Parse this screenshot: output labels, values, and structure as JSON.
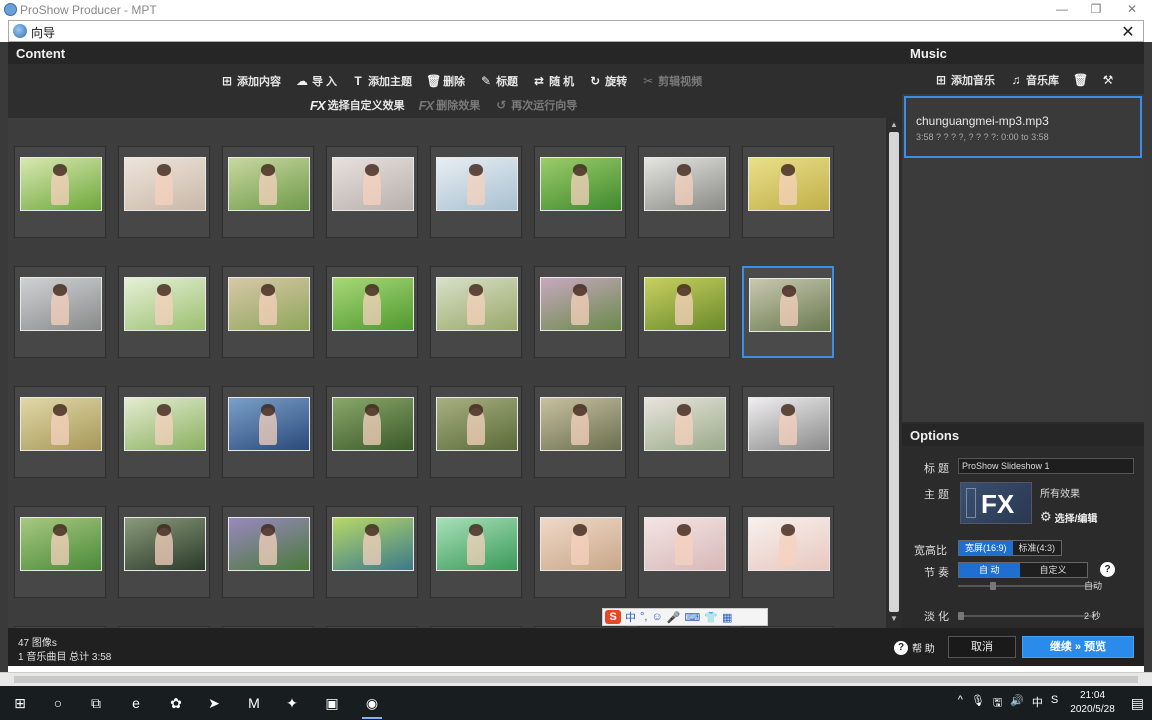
{
  "app": {
    "title": "ProShow Producer - MPT",
    "window_buttons": [
      "—",
      "❐",
      "✕"
    ]
  },
  "dialog": {
    "title": "向导",
    "close": "✕"
  },
  "content": {
    "header": "Content",
    "toolbar_row1": [
      {
        "icon": "plus-square-icon",
        "glyph": "⊞",
        "label": "添加内容",
        "dim": false
      },
      {
        "icon": "cloud-upload-icon",
        "glyph": "☁",
        "label": "导 入",
        "dim": false
      },
      {
        "icon": "title-text-icon",
        "glyph": "T",
        "label": "添加主题",
        "dim": false
      },
      {
        "icon": "trash-icon",
        "glyph": "🗑",
        "label": "删除",
        "dim": false
      },
      {
        "icon": "pencil-icon",
        "glyph": "✎",
        "label": "标题",
        "dim": false
      },
      {
        "icon": "shuffle-icon",
        "glyph": "⇄",
        "label": "随 机",
        "dim": false
      },
      {
        "icon": "rotate-icon",
        "glyph": "↻",
        "label": "旋转",
        "dim": false
      },
      {
        "icon": "crop-edit-icon",
        "glyph": "✂",
        "label": "剪辑视频",
        "dim": true
      }
    ],
    "toolbar_row2": [
      {
        "icon": "fx-icon",
        "glyph": "FX",
        "label": "选择自定义效果",
        "dim": false
      },
      {
        "icon": "fx-remove-icon",
        "glyph": "FX",
        "label": "删除效果",
        "dim": true
      },
      {
        "icon": "rerun-wizard-icon",
        "glyph": "↺",
        "label": "再次运行向导",
        "dim": true
      }
    ],
    "status_line1": "47 图像s",
    "status_line2": "1 音乐曲目 总计 3:58"
  },
  "thumbnails": {
    "rows": 4,
    "cols": 8,
    "selected_index": 15,
    "palettes": [
      [
        "#6ea83c",
        "#d8e8b0"
      ],
      [
        "#c9b8a8",
        "#eee4dc"
      ],
      [
        "#6f9a4a",
        "#c8d8a0"
      ],
      [
        "#b8b0ac",
        "#e8e0dc"
      ],
      [
        "#a8c0d0",
        "#e8eef2"
      ],
      [
        "#3f8a2e",
        "#9ccc6a"
      ],
      [
        "#8a8a86",
        "#e4e4e0"
      ],
      [
        "#c0b048",
        "#eadf8a"
      ],
      [
        "#8a8a8a",
        "#cfd2d4"
      ],
      [
        "#9cc070",
        "#e6f0d8"
      ],
      [
        "#8ea65a",
        "#d8c8a8"
      ],
      [
        "#4f9a2e",
        "#a8d878"
      ],
      [
        "#9aa86a",
        "#d8e0c8"
      ],
      [
        "#6a8a4a",
        "#c8a8c0"
      ],
      [
        "#6a8a2a",
        "#c8d060"
      ],
      [
        "#6a7a50",
        "#c8c8b0"
      ],
      [
        "#a89858",
        "#e0d8a8"
      ],
      [
        "#8ab060",
        "#e4ecd0"
      ],
      [
        "#2a4a7a",
        "#7aa0c8"
      ],
      [
        "#3a5a2a",
        "#8aa86a"
      ],
      [
        "#5a6a3a",
        "#a8b080"
      ],
      [
        "#6a7050",
        "#c8c0a0"
      ],
      [
        "#9aaa8a",
        "#e8e4dc"
      ],
      [
        "#8a8a8a",
        "#f0eef0"
      ],
      [
        "#4a8a3a",
        "#a8c880"
      ],
      [
        "#2a3a2a",
        "#8a9a7a"
      ],
      [
        "#4a7a3a",
        "#9a88c0"
      ],
      [
        "#3a7a8a",
        "#b8d868"
      ],
      [
        "#3a9a5a",
        "#a8e0b8"
      ],
      [
        "#c8a888",
        "#f0d8c8"
      ],
      [
        "#d8b8b8",
        "#f4e4e4"
      ],
      [
        "#e8c8c0",
        "#f8f0ec"
      ]
    ]
  },
  "music": {
    "header": "Music",
    "toolbar": [
      {
        "icon": "plus-square-icon",
        "glyph": "⊞",
        "label": "添加音乐"
      },
      {
        "icon": "music-note-icon",
        "glyph": "♫",
        "label": "音乐库"
      },
      {
        "icon": "trash-icon",
        "glyph": "🗑",
        "label": ""
      },
      {
        "icon": "tools-icon",
        "glyph": "⚒",
        "label": ""
      }
    ],
    "track_name": "chunguangmei-mp3.mp3",
    "track_info": "3:58 ? ? ? ?, ? ? ? ?: 0:00 to 3:58"
  },
  "options": {
    "header": "Options",
    "title_label": "标 题",
    "title_value": "ProShow Slideshow 1",
    "theme_label": "主 题",
    "theme_all": "所有效果",
    "theme_edit": "选择/编辑",
    "aspect_label": "宽高比",
    "aspect_options": [
      "宽屏(16:9)",
      "标准(4:3)"
    ],
    "aspect_selected": 0,
    "rhythm_label": "节 奏",
    "rhythm_options": [
      "自 动",
      "自定义"
    ],
    "rhythm_selected": 0,
    "rhythm_value": "自动",
    "fade_label": "淡 化",
    "fade_value": "2 秒"
  },
  "actions": {
    "help": "帮 助",
    "cancel": "取消",
    "continue": "继续 » 预览"
  },
  "ime": {
    "labels": [
      "中",
      "°,",
      "☺",
      "🎤",
      "⌨",
      "👕",
      "▦"
    ]
  },
  "taskbar": {
    "apps": [
      {
        "name": "start-button",
        "glyph": "⊞",
        "active": false
      },
      {
        "name": "cortana-icon",
        "glyph": "○",
        "active": false
      },
      {
        "name": "task-view-icon",
        "glyph": "⧉",
        "active": false
      },
      {
        "name": "edge-icon",
        "glyph": "e",
        "active": false
      },
      {
        "name": "app-purple-icon",
        "glyph": "✿",
        "active": false
      },
      {
        "name": "app-blue-icon",
        "glyph": "➤",
        "active": false
      },
      {
        "name": "app-dark-icon",
        "glyph": "M",
        "active": false
      },
      {
        "name": "app-red-icon",
        "glyph": "✦",
        "active": false
      },
      {
        "name": "app-store-icon",
        "glyph": "▣",
        "active": false
      },
      {
        "name": "proshow-icon",
        "glyph": "◉",
        "active": true
      }
    ],
    "tray": [
      "^",
      "🎙",
      "🖫",
      "🔊",
      "中",
      "S"
    ],
    "time": "21:04",
    "date": "2020/5/28",
    "notification": "▤"
  }
}
